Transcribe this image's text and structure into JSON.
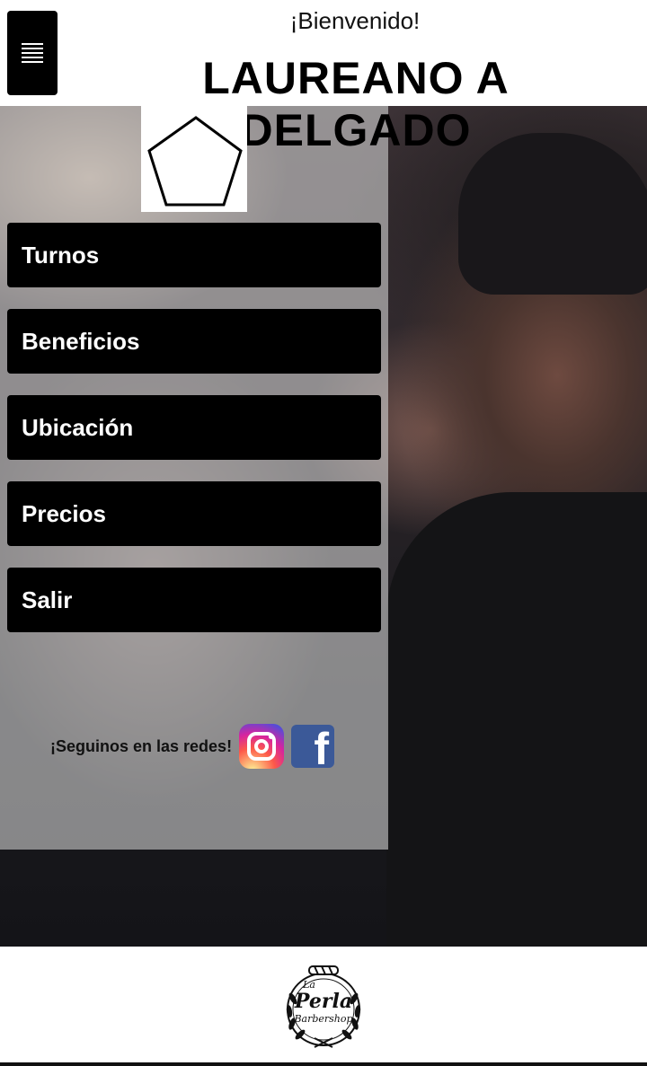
{
  "header": {
    "welcome": "¡Bienvenido!",
    "user_name": "LAUREANO A DELGADO",
    "menu_icon": "hamburger-icon"
  },
  "logo_icon": "pentagon-icon",
  "nav": [
    {
      "label": "Turnos"
    },
    {
      "label": "Beneficios"
    },
    {
      "label": "Ubicación"
    },
    {
      "label": "Precios"
    },
    {
      "label": "Salir"
    }
  ],
  "social": {
    "label": "¡Seguinos en las redes!",
    "instagram_icon": "instagram-icon",
    "facebook_icon": "facebook-icon"
  },
  "footer": {
    "brand_top": "La",
    "brand_name": "Perla",
    "brand_sub": "Barbershop"
  },
  "colors": {
    "button_bg": "#000000",
    "button_text": "#ffffff",
    "panel_overlay": "#cdcdcd",
    "facebook": "#3b5998"
  }
}
